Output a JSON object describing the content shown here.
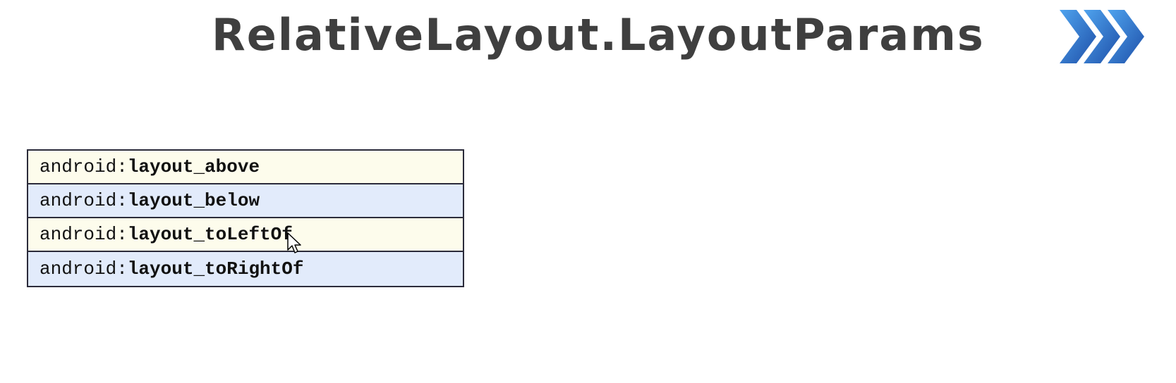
{
  "slide": {
    "title": "RelativeLayout.LayoutParams",
    "title_color": "#3f3f3f",
    "accent_color": "#2a6fc9",
    "icon": "chevron-right-triple-icon"
  },
  "attributes": {
    "rows": [
      {
        "prefix": "android:",
        "name": "layout_above"
      },
      {
        "prefix": "android:",
        "name": "layout_below"
      },
      {
        "prefix": "android:",
        "name": "layout_toLeftOf"
      },
      {
        "prefix": "android:",
        "name": "layout_toRightOf"
      }
    ],
    "row_colors": [
      "#fdfcec",
      "#e2ebfb"
    ]
  },
  "cursor": {
    "icon": "mouse-pointer-icon"
  }
}
